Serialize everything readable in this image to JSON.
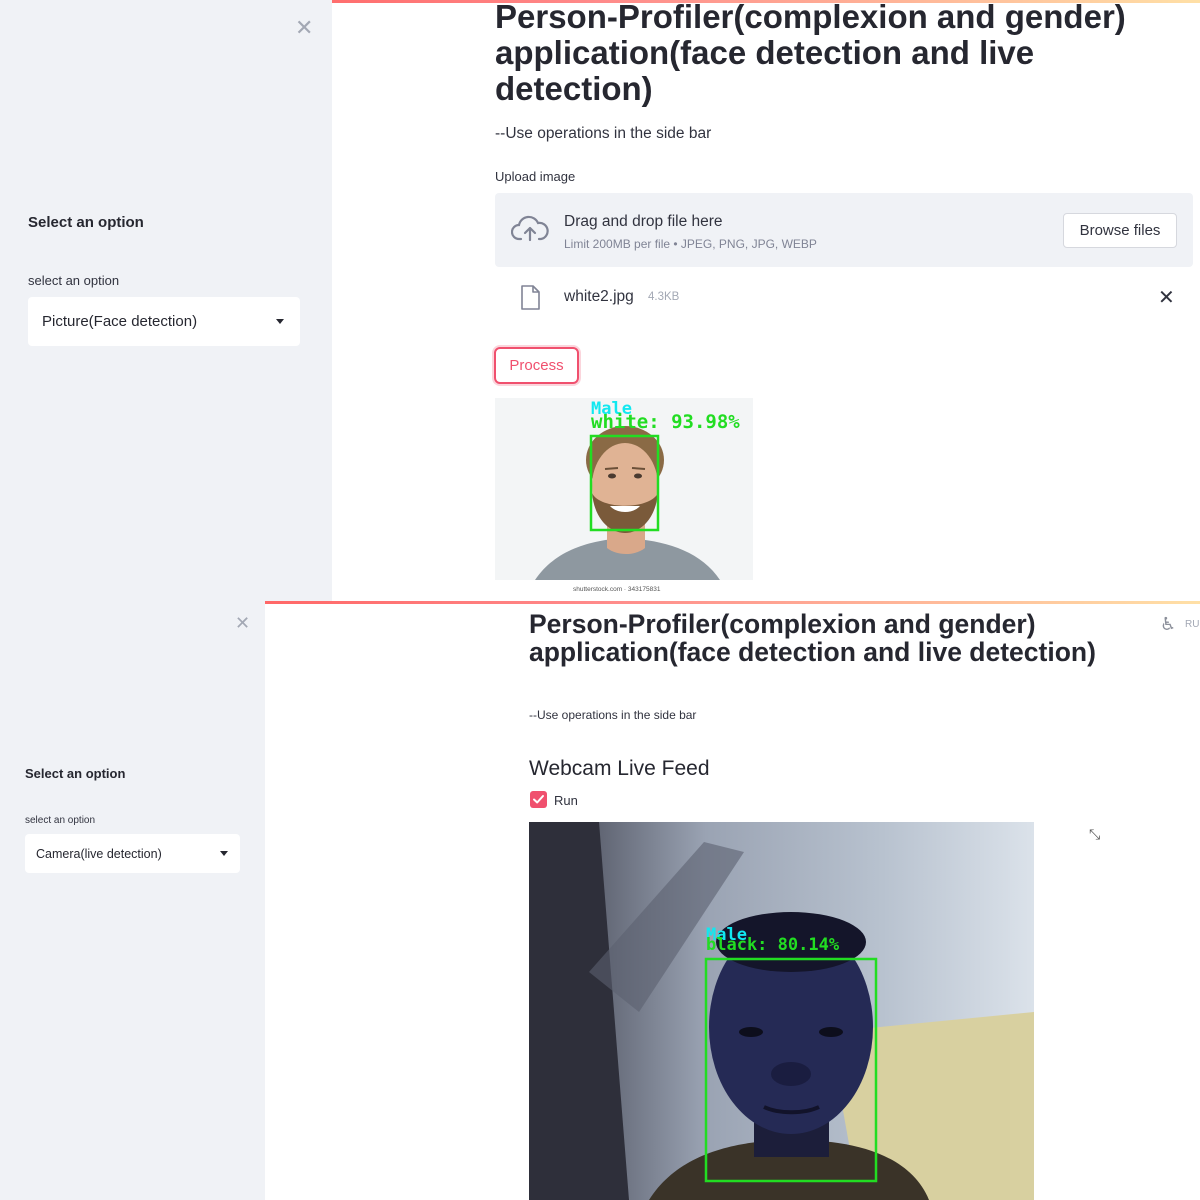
{
  "top": {
    "sidebar": {
      "heading": "Select an option",
      "select_label": "select an option",
      "selected": "Picture(Face detection)"
    },
    "main": {
      "title": "Person-Profiler(complexion and gender) application(face detection and live detection)",
      "subtitle": "--Use operations in the side bar",
      "upload_label": "Upload image",
      "dropzone_main": "Drag and drop file here",
      "dropzone_sub": "Limit 200MB per file • JPEG, PNG, JPG, WEBP",
      "browse_label": "Browse files",
      "file_name": "white2.jpg",
      "file_size": "4.3KB",
      "process_label": "Process",
      "detection": {
        "gender": "Male",
        "complexion": "white:  93.98%",
        "watermark": "shutterstock.com · 343175831"
      }
    }
  },
  "bottom": {
    "sidebar": {
      "heading": "Select an option",
      "select_label": "select an option",
      "selected": "Camera(live detection)"
    },
    "main": {
      "title": "Person-Profiler(complexion and gender) application(face detection and live detection)",
      "subtitle": "--Use operations in the side bar",
      "feed_heading": "Webcam Live Feed",
      "run_label": "Run",
      "run_checked": true,
      "running_text": "RU",
      "detection": {
        "gender": "Male",
        "complexion": "black: 80.14%"
      }
    }
  },
  "colors": {
    "accent": "#f0506e",
    "sidebar_bg": "#f0f2f6",
    "box_green": "#22dd22",
    "label_cyan": "#11e8f0"
  },
  "icons": {
    "close": "close-icon",
    "upload": "cloud-upload-icon",
    "file": "file-icon",
    "remove": "close-icon",
    "accessibility": "accessibility-icon",
    "fullscreen": "fullscreen-icon"
  }
}
